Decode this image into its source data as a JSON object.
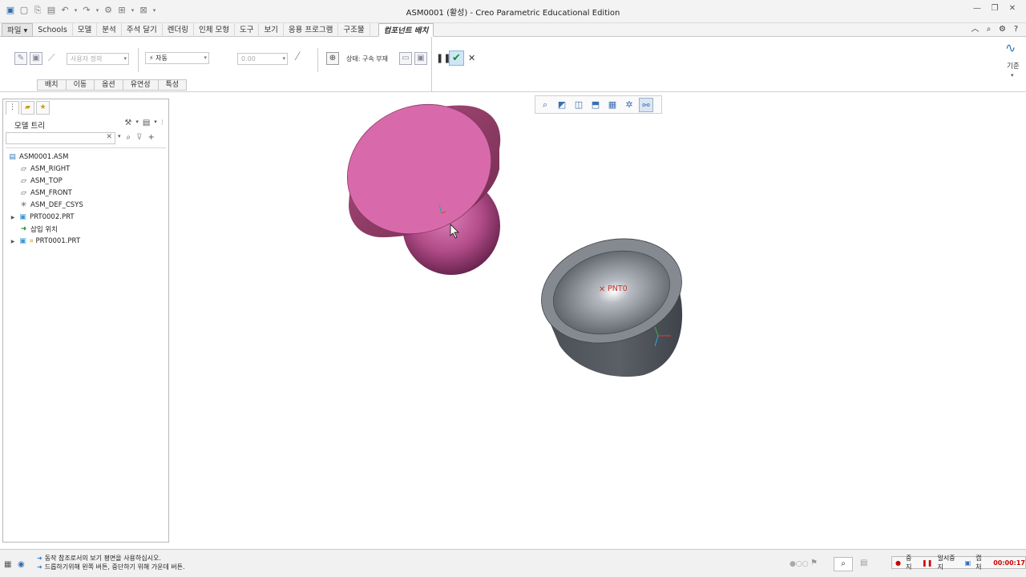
{
  "window": {
    "title": "ASM0001 (활성) - Creo Parametric Educational Edition"
  },
  "menu": {
    "items": [
      "파일",
      "Schools",
      "모델",
      "분석",
      "주석 달기",
      "렌더링",
      "인체 모형",
      "도구",
      "보기",
      "응용 프로그램",
      "구조물"
    ],
    "active_tab": "컴포넌트 배치"
  },
  "ribbon": {
    "constraint_preset": "사용자 정의",
    "constraint_type": "자동",
    "offset_value": "0.00",
    "status_label": "상태: 구속 부재",
    "subtabs": [
      "배치",
      "이동",
      "옵션",
      "유연성",
      "특성"
    ],
    "datum_label": "기준"
  },
  "model_tree": {
    "header": "모델 트리",
    "nodes": [
      {
        "label": "ASM0001.ASM",
        "icon": "assembly-icon",
        "expandable": false
      },
      {
        "label": "ASM_RIGHT",
        "icon": "datum-plane-icon",
        "expandable": false
      },
      {
        "label": "ASM_TOP",
        "icon": "datum-plane-icon",
        "expandable": false
      },
      {
        "label": "ASM_FRONT",
        "icon": "datum-plane-icon",
        "expandable": false
      },
      {
        "label": "ASM_DEF_CSYS",
        "icon": "csys-icon",
        "expandable": false
      },
      {
        "label": "PRT0002.PRT",
        "icon": "part-icon",
        "expandable": true
      },
      {
        "label": "삽입 위치",
        "icon": "insert-arrow-icon",
        "expandable": false
      },
      {
        "label": "PRT0001.PRT",
        "icon": "part-icon",
        "expandable": true
      }
    ]
  },
  "viewport": {
    "point_label": "PNT0",
    "colors": {
      "pink_top": "#d86aab",
      "pink_side": "#9c3d73",
      "gray_body": "#5b5f66",
      "rim": "#8a8f96"
    }
  },
  "status": {
    "messages": [
      "동작 참조로서의 보기 평면을 사용하십시오.",
      "드롭하기위해 왼쪽 버튼, 중단하기 위해 가운데 버튼."
    ]
  },
  "recorder": {
    "stop": "중지",
    "pause": "일시중지",
    "capture": "캡처",
    "time": "00:00:17"
  }
}
